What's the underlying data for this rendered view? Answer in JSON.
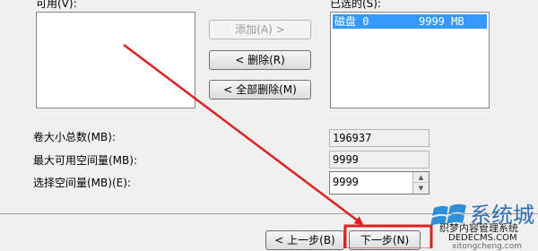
{
  "available": {
    "label": "可用(V):"
  },
  "selected": {
    "label": "已选的(S):",
    "rows": [
      {
        "name": "磁盘 0",
        "size": "9999 MB"
      }
    ]
  },
  "buttons": {
    "add": "添加(A) >",
    "remove": "< 删除(R)",
    "remove_all": "< 全部删除(M)",
    "back": "< 上一步(B)",
    "next": "下一步(N)"
  },
  "fields": {
    "total_label": "卷大小总数(MB):",
    "total_value": "196937",
    "max_label": "最大可用空间量(MB):",
    "max_value": "9999",
    "select_label": "选择空间量(MB)(E):",
    "select_value": "9999"
  },
  "watermark": {
    "brand": "系统城",
    "line1": "织梦内容管理系统",
    "line2": "DEDECMS.COM",
    "line3": "xitongcheng.com"
  },
  "colors": {
    "annotation": "#e02020",
    "selection": "#3399ff"
  }
}
